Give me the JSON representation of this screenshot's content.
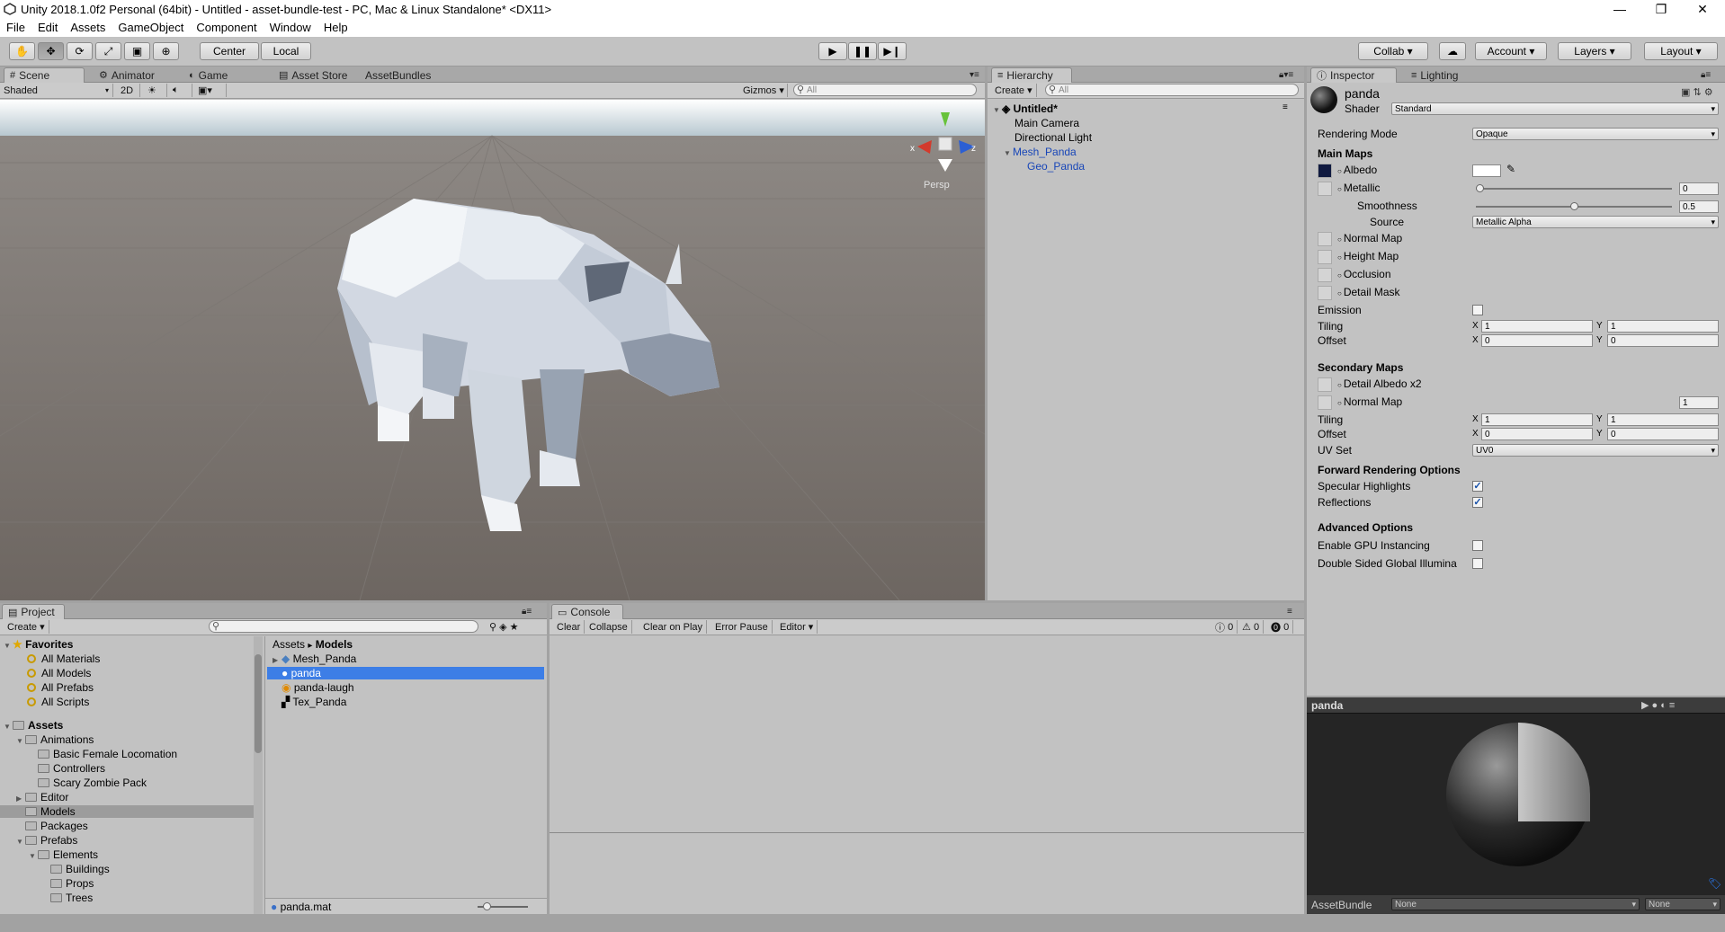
{
  "window": {
    "title": "Unity 2018.1.0f2 Personal (64bit) - Untitled - asset-bundle-test - PC, Mac & Linux Standalone* <DX11>",
    "minimize": "—",
    "maximize": "❐",
    "close": "✕"
  },
  "menu": [
    "File",
    "Edit",
    "Assets",
    "GameObject",
    "Component",
    "Window",
    "Help"
  ],
  "toolbar": {
    "center_label": "Center",
    "local_label": "Local",
    "collab_label": "Collab ▾",
    "account_label": "Account",
    "layers_label": "Layers",
    "layout_label": "Layout"
  },
  "scene": {
    "tabs": [
      "Scene",
      "Animator",
      "Game",
      "Asset Store",
      "AssetBundles"
    ],
    "shading": "Shaded",
    "mode_2d": "2D",
    "gizmos": "Gizmos",
    "search_placeholder": "All",
    "persp_label": "Persp",
    "axis_x": "x",
    "axis_z": "z",
    "sky_color": "#c8dde8",
    "ground_color": "#716a66"
  },
  "hierarchy": {
    "tab": "Hierarchy",
    "create": "Create",
    "search_placeholder": "All",
    "scene_name": "Untitled*",
    "items": [
      "Main Camera",
      "Directional Light",
      "Mesh_Panda",
      "Geo_Panda"
    ]
  },
  "inspector": {
    "tabs": [
      "Inspector",
      "Lighting"
    ],
    "object_name": "panda",
    "shader_label": "Shader",
    "shader_value": "Standard",
    "rendering_mode_label": "Rendering Mode",
    "rendering_mode_value": "Opaque",
    "main_maps": "Main Maps",
    "albedo": "Albedo",
    "metallic": "Metallic",
    "metallic_value": "0",
    "metallic_level": 0.0,
    "smoothness": "Smoothness",
    "smoothness_value": "0.5",
    "smoothness_level": 0.5,
    "source_label": "Source",
    "source_value": "Metallic Alpha",
    "normal_map": "Normal Map",
    "height_map": "Height Map",
    "occlusion": "Occlusion",
    "detail_mask": "Detail Mask",
    "emission": "Emission",
    "tiling": "Tiling",
    "offset": "Offset",
    "x": "X",
    "y": "Y",
    "tiling_x": "1",
    "tiling_y": "1",
    "offset_x": "0",
    "offset_y": "0",
    "secondary_maps": "Secondary Maps",
    "detail_albedo": "Detail Albedo x2",
    "normal_map2": "Normal Map",
    "normal_map2_value": "1",
    "tiling2_x": "1",
    "tiling2_y": "1",
    "offset2_x": "0",
    "offset2_y": "0",
    "uv_set_label": "UV Set",
    "uv_set_value": "UV0",
    "forward_options": "Forward Rendering Options",
    "specular": "Specular Highlights",
    "reflections": "Reflections",
    "advanced": "Advanced Options",
    "gpu_instancing": "Enable GPU Instancing",
    "double_sided": "Double Sided Global Illumina",
    "preview_title": "panda",
    "assetbundle_label": "AssetBundle",
    "assetbundle_value": "None",
    "assetbundle_variant": "None"
  },
  "project": {
    "tab": "Project",
    "create": "Create",
    "favorites": "Favorites",
    "favorite_items": [
      "All Materials",
      "All Models",
      "All Prefabs",
      "All Scripts"
    ],
    "assets_root": "Assets",
    "tree": [
      {
        "label": "Animations",
        "depth": 1,
        "open": true
      },
      {
        "label": "Basic Female Locomation",
        "depth": 2,
        "open": false
      },
      {
        "label": "Controllers",
        "depth": 2,
        "open": false
      },
      {
        "label": "Scary Zombie Pack",
        "depth": 2,
        "open": false
      },
      {
        "label": "Editor",
        "depth": 1,
        "open": false
      },
      {
        "label": "Models",
        "depth": 1,
        "open": false
      },
      {
        "label": "Packages",
        "depth": 1,
        "open": false
      },
      {
        "label": "Prefabs",
        "depth": 1,
        "open": true
      },
      {
        "label": "Elements",
        "depth": 2,
        "open": true
      },
      {
        "label": "Buildings",
        "depth": 3,
        "open": false
      },
      {
        "label": "Props",
        "depth": 3,
        "open": false
      },
      {
        "label": "Trees",
        "depth": 3,
        "open": false
      }
    ],
    "breadcrumb_root": "Assets",
    "breadcrumb_sep": "▸",
    "breadcrumb_current": "Models",
    "files": [
      "Mesh_Panda",
      "panda",
      "panda-laugh",
      "Tex_Panda"
    ],
    "footer_file": "panda.mat"
  },
  "console": {
    "tab": "Console",
    "buttons": [
      "Clear",
      "Collapse",
      "Clear on Play",
      "Error Pause",
      "Editor"
    ],
    "info_count": "0",
    "warn_count": "0",
    "error_count": "0"
  }
}
